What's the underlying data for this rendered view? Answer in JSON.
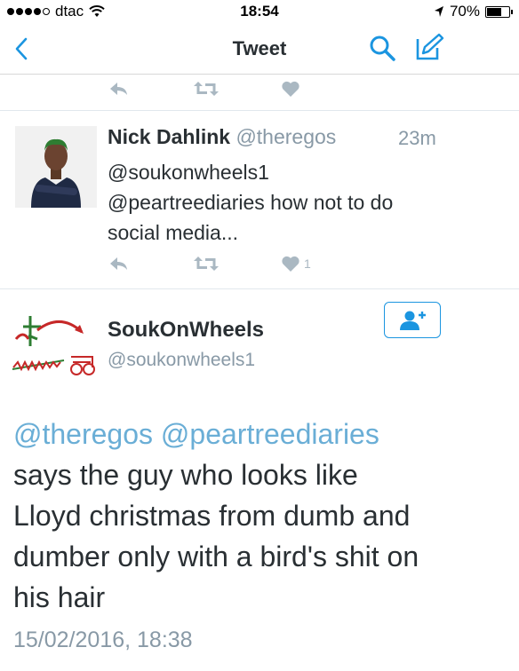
{
  "status_bar": {
    "carrier": "dtac",
    "time": "18:54",
    "battery_text": "70%",
    "battery_level": 0.7
  },
  "nav": {
    "title": "Tweet"
  },
  "reply_tweet": {
    "name": "Nick Dahlink",
    "handle": "@theregos",
    "time_ago": "23m",
    "text_line1": "@soukonwheels1",
    "text_line2": "@peartreediaries how not to do",
    "text_line3": "social media...",
    "like_count": "1"
  },
  "main_tweet": {
    "name": "SoukOnWheels",
    "handle": "@soukonwheels1",
    "mention1": "@theregos",
    "mention2": "@peartreediaries",
    "line2": "says the guy who looks like",
    "line3": "Lloyd christmas from dumb and",
    "line4": "dumber only with a bird's shit on",
    "line5": "his hair",
    "date": "15/02/2016, 18:38"
  },
  "colors": {
    "accent": "#1b95e0",
    "mention": "#6aaed6",
    "muted": "#8899a6",
    "action_icon": "#aab8c2"
  },
  "icons": [
    "back-chevron-icon",
    "search-icon",
    "compose-icon",
    "reply-icon",
    "retweet-icon",
    "heart-icon",
    "follow-user-icon",
    "wifi-icon",
    "location-arrow-icon",
    "battery-icon"
  ]
}
